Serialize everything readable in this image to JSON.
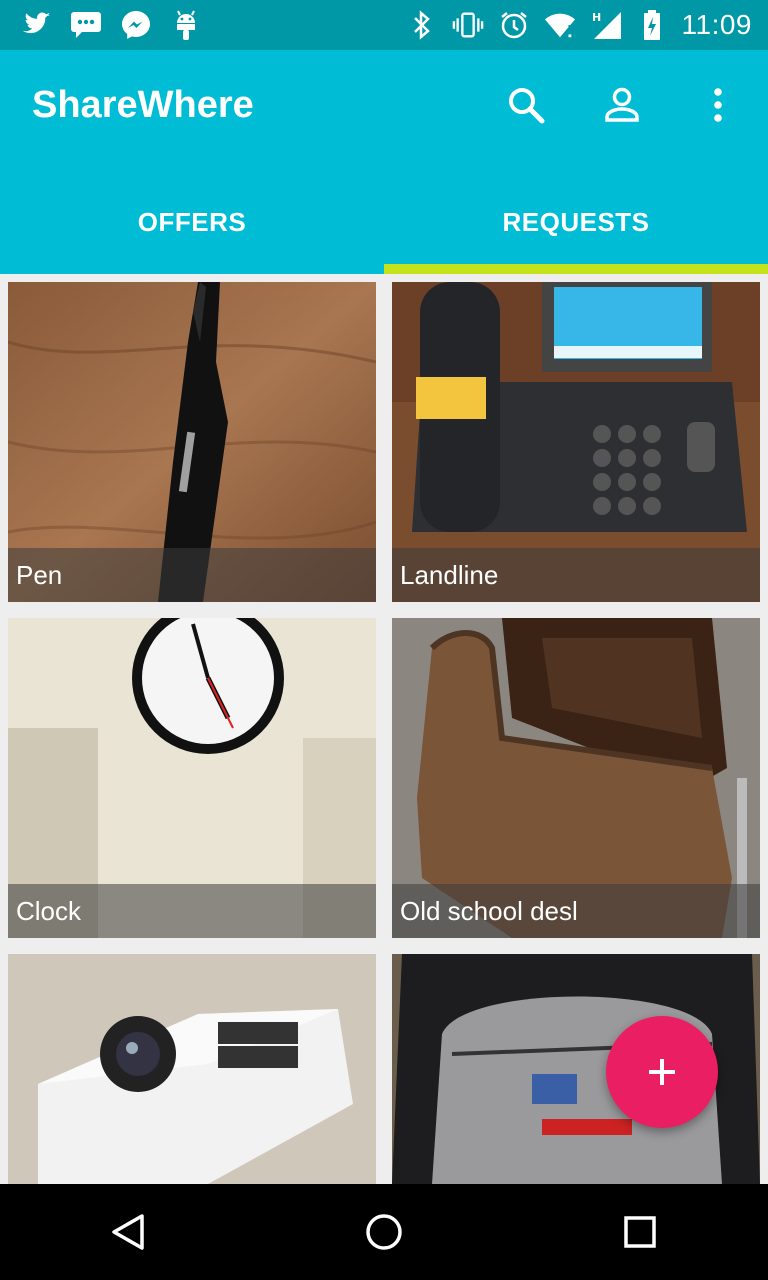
{
  "status_bar": {
    "time": "11:09",
    "notification_icons": [
      "twitter-icon",
      "message-icon",
      "messenger-icon",
      "android-icon"
    ],
    "system_icons": [
      "bluetooth-icon",
      "vibrate-icon",
      "alarm-icon",
      "wifi-icon",
      "signal-icon",
      "battery-icon"
    ]
  },
  "app_bar": {
    "title": "ShareWhere",
    "actions": [
      "search-icon",
      "account-icon",
      "overflow-menu-icon"
    ],
    "color": "#00bcd4"
  },
  "tabs": [
    {
      "label": "OFFERS",
      "active": false
    },
    {
      "label": "REQUESTS",
      "active": true
    }
  ],
  "tab_indicator_color": "#c6e21a",
  "items": [
    {
      "label": "Pen"
    },
    {
      "label": "Landline"
    },
    {
      "label": "Clock"
    },
    {
      "label": "Old school desl"
    },
    {
      "label": ""
    },
    {
      "label": ""
    }
  ],
  "fab": {
    "icon": "add-icon",
    "color": "#e91e63"
  },
  "nav_bar": {
    "buttons": [
      "back-icon",
      "home-icon",
      "recents-icon"
    ]
  }
}
